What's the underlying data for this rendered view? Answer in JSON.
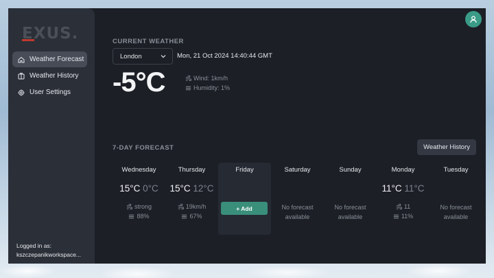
{
  "brand": {
    "logo_text": "EXUS."
  },
  "sidebar": {
    "items": [
      {
        "label": "Weather Forecast",
        "icon": "home-icon",
        "active": true
      },
      {
        "label": "Weather History",
        "icon": "history-icon",
        "active": false
      },
      {
        "label": "User Settings",
        "icon": "gear-icon",
        "active": false
      }
    ],
    "logged_in_label": "Logged in as:",
    "logged_in_user": "kszczepanikworkspace..."
  },
  "header": {
    "avatar_icon": "user-icon",
    "avatar_color": "#3a9b87"
  },
  "current": {
    "section_title": "CURRENT WEATHER",
    "city": "London",
    "datetime": "Mon, 21 Oct 2024 14:40:44 GMT",
    "temperature": "-5°C",
    "wind": "Wind: 1km/h",
    "humidity": "Humidity: 1%"
  },
  "forecast": {
    "section_title": "7-DAY FORECAST",
    "history_button": "Weather History",
    "add_button": "+ Add",
    "no_forecast_line1": "No forecast",
    "no_forecast_line2": "available",
    "days": [
      {
        "name": "Wednesday",
        "high": "15°C",
        "low": "0°C",
        "wind": "strong",
        "humidity": "88%"
      },
      {
        "name": "Thursday",
        "high": "15°C",
        "low": "12°C",
        "wind": "19km/h",
        "humidity": "67%"
      },
      {
        "name": "Friday"
      },
      {
        "name": "Saturday"
      },
      {
        "name": "Sunday"
      },
      {
        "name": "Monday",
        "high": "11°C",
        "low": "11°C",
        "wind": "11",
        "humidity": "11%"
      },
      {
        "name": "Tuesday"
      }
    ]
  },
  "colors": {
    "accent": "#3a8f7b",
    "brand_red": "#c0392b",
    "background": "#1c1f26",
    "sidebar": "#2b2f38"
  }
}
